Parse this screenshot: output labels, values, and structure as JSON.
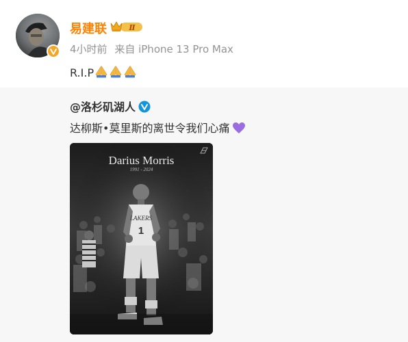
{
  "post": {
    "author": "易建联",
    "vip_level": "Ⅱ",
    "time": "4小时前",
    "source": "来自 iPhone 13 Pro Max",
    "text": "R.I.P",
    "emojis": [
      "pray-emoji",
      "pray-emoji",
      "pray-emoji"
    ]
  },
  "repost": {
    "author": "@洛杉矶湖人",
    "text": "达柳斯•莫里斯的离世令我们心痛",
    "image": {
      "name": "Darius Morris",
      "years": "1991 - 2024",
      "jersey_text": "LAKERS",
      "jersey_number": "1"
    }
  },
  "colors": {
    "username": "#ff8200",
    "meta": "#939393",
    "repost_bg": "#f7f7f7",
    "verified_blue": "#1296db",
    "heart": "#9b6ee0"
  }
}
